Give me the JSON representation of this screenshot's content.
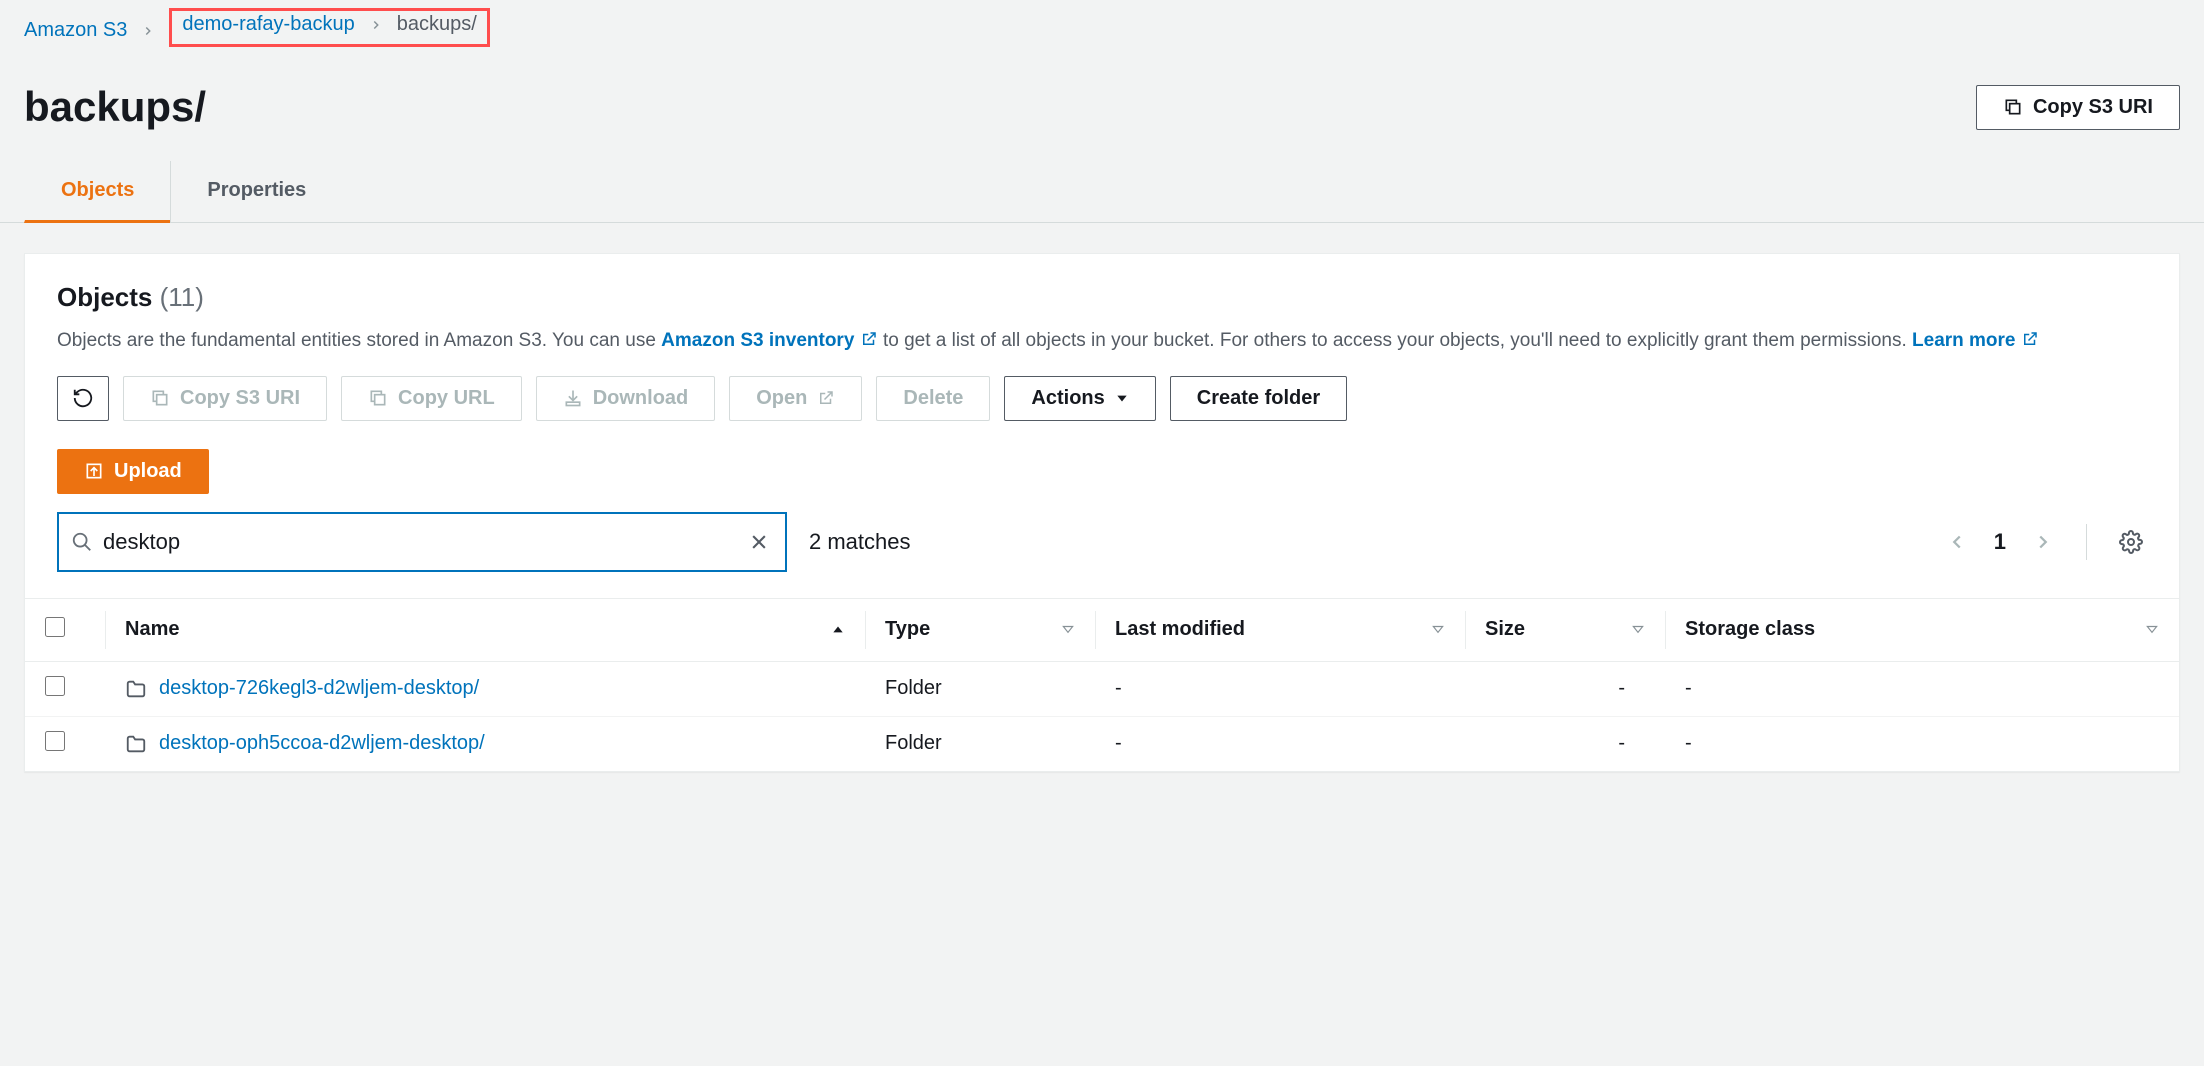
{
  "breadcrumb": {
    "root": "Amazon S3",
    "bucket": "demo-rafay-backup",
    "current": "backups/"
  },
  "page_title": "backups/",
  "copy_uri_btn": "Copy S3 URI",
  "tabs": {
    "objects": "Objects",
    "properties": "Properties"
  },
  "panel": {
    "heading": "Objects",
    "count": "(11)",
    "desc_prefix": "Objects are the fundamental entities stored in Amazon S3. You can use ",
    "inventory_link": "Amazon S3 inventory",
    "desc_mid": " to get a list of all objects in your bucket. For others to access your objects, you'll need to explicitly grant them permissions. ",
    "learn_more": "Learn more"
  },
  "toolbar": {
    "copy_uri": "Copy S3 URI",
    "copy_url": "Copy URL",
    "download": "Download",
    "open": "Open",
    "delete": "Delete",
    "actions": "Actions",
    "create_folder": "Create folder",
    "upload": "Upload"
  },
  "search": {
    "value": "desktop",
    "matches": "2 matches",
    "page": "1"
  },
  "table": {
    "headers": {
      "name": "Name",
      "type": "Type",
      "last_modified": "Last modified",
      "size": "Size",
      "storage_class": "Storage class"
    },
    "rows": [
      {
        "name": "desktop-726kegl3-d2wljem-desktop/",
        "type": "Folder",
        "last_modified": "-",
        "size": "-",
        "storage_class": "-"
      },
      {
        "name": "desktop-oph5ccoa-d2wljem-desktop/",
        "type": "Folder",
        "last_modified": "-",
        "size": "-",
        "storage_class": "-"
      }
    ]
  }
}
